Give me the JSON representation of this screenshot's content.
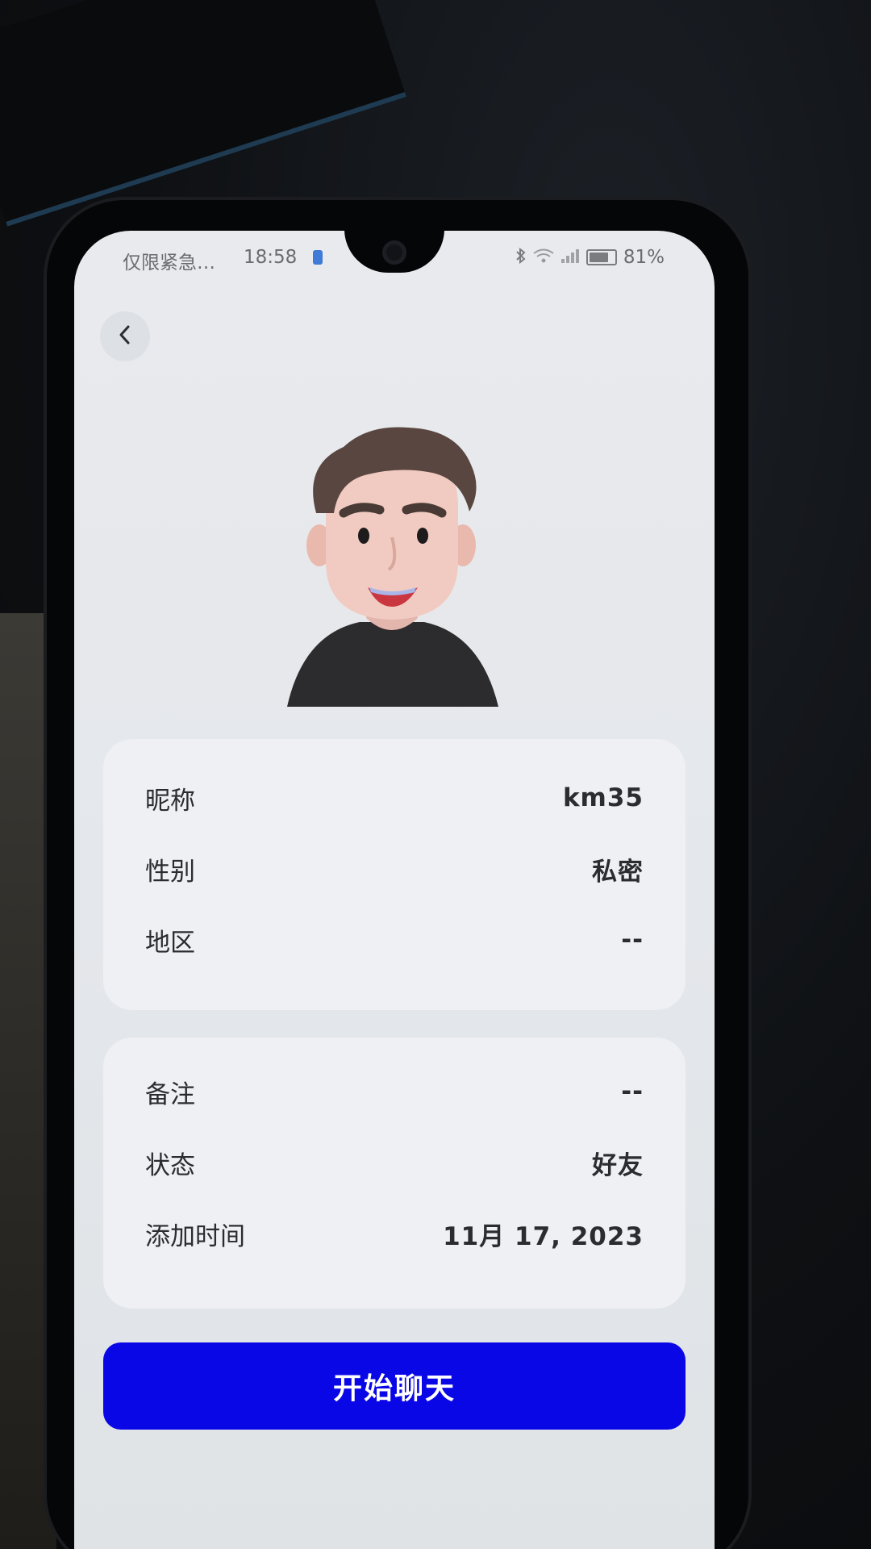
{
  "status_bar": {
    "carrier": "仅限紧急…",
    "time": "18:58",
    "battery": "81%",
    "battery_level": 0.81
  },
  "profile_info": [
    {
      "label": "昵称",
      "value": "km35"
    },
    {
      "label": "性别",
      "value": "私密"
    },
    {
      "label": "地区",
      "value": "--"
    }
  ],
  "relation_info": [
    {
      "label": "备注",
      "value": "--"
    },
    {
      "label": "状态",
      "value": "好友"
    },
    {
      "label": "添加时间",
      "value": "11月 17, 2023"
    }
  ],
  "actions": {
    "start_chat": "开始聊天"
  },
  "colors": {
    "primary_button": "#0a07e6",
    "card_bg": "#eef0f3",
    "screen_bg": "#e6e8ec"
  },
  "icons": {
    "back": "chevron-left-icon",
    "bluetooth": "bluetooth-icon",
    "wifi": "wifi-icon",
    "signal": "signal-icon",
    "battery": "battery-icon"
  }
}
